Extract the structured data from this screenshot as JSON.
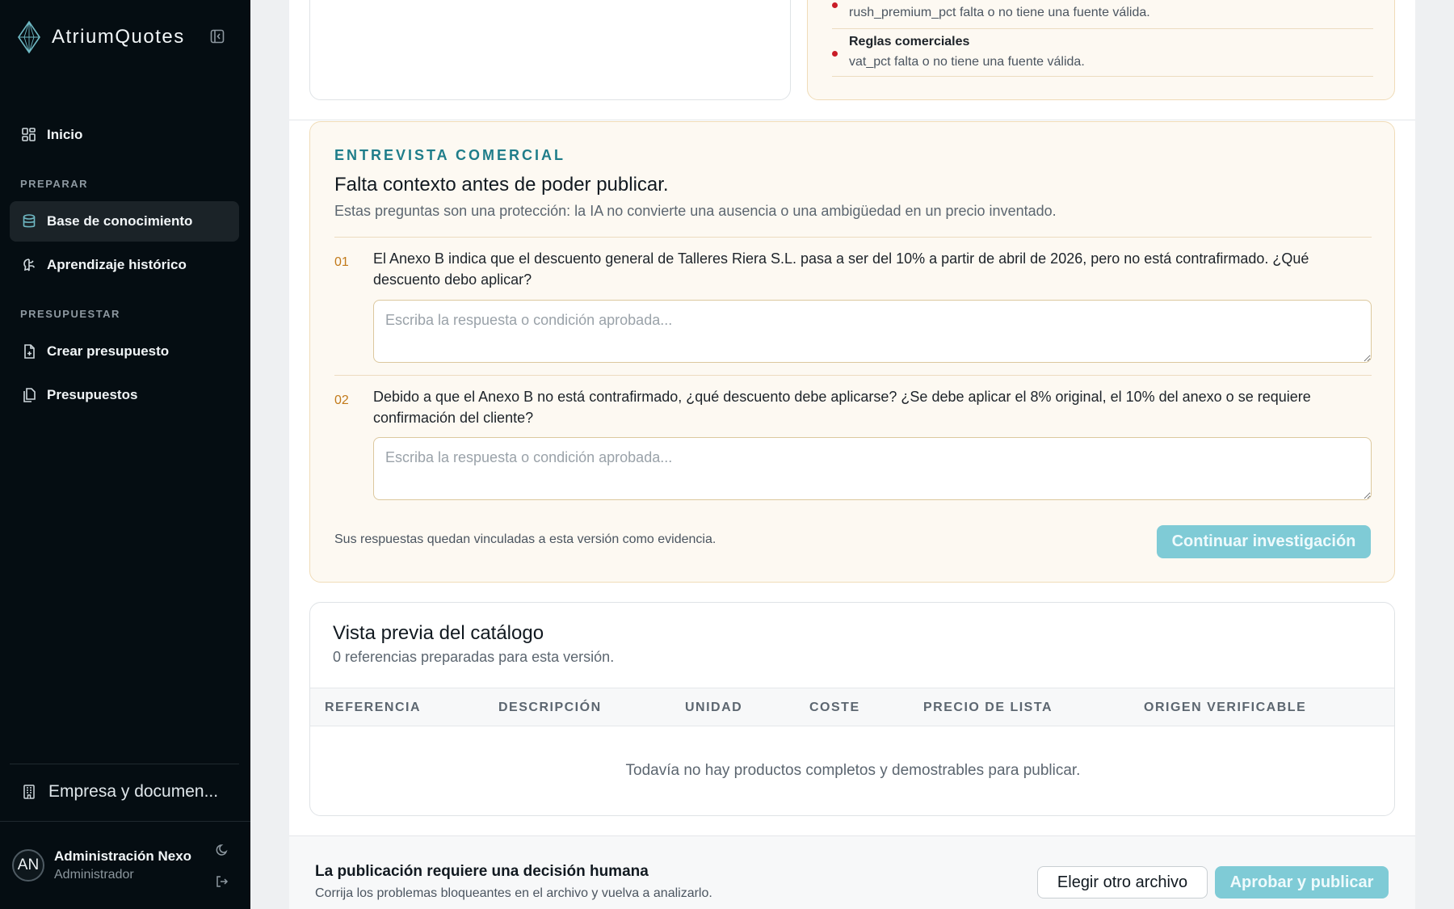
{
  "app": {
    "name": "AtriumQuotes"
  },
  "sidebar": {
    "home": "Inicio",
    "section_prepare": "PREPARAR",
    "knowledge_base": "Base de conocimiento",
    "historical_learning": "Aprendizaje histórico",
    "section_budget": "PRESUPUESTAR",
    "create_quote": "Crear presupuesto",
    "quotes": "Presupuestos",
    "company": "Empresa y documen...",
    "user": {
      "initials": "AN",
      "name": "Administración Nexo",
      "role": "Administrador"
    }
  },
  "issues": [
    {
      "title": "",
      "desc": "rush_premium_pct falta o no tiene una fuente válida."
    },
    {
      "title": "Reglas comerciales",
      "desc": "vat_pct falta o no tiene una fuente válida."
    }
  ],
  "interview": {
    "eyebrow": "ENTREVISTA COMERCIAL",
    "title": "Falta contexto antes de poder publicar.",
    "subtitle": "Estas preguntas son una protección: la IA no convierte una ausencia o una ambigüedad en un precio inventado.",
    "questions": [
      {
        "num": "01",
        "text": "El Anexo B indica que el descuento general de Talleres Riera S.L. pasa a ser del 10% a partir de abril de 2026, pero no está contrafirmado. ¿Qué descuento debo aplicar?",
        "placeholder": "Escriba la respuesta o condición aprobada...",
        "value": ""
      },
      {
        "num": "02",
        "text": "Debido a que el Anexo B no está contrafirmado, ¿qué descuento debe aplicarse? ¿Se debe aplicar el 8% original, el 10% del anexo o se requiere confirmación del cliente?",
        "placeholder": "Escriba la respuesta o condición aprobada...",
        "value": ""
      }
    ],
    "footer_note": "Sus respuestas quedan vinculadas a esta versión como evidencia.",
    "continue_label": "Continuar investigación"
  },
  "catalog": {
    "title": "Vista previa del catálogo",
    "subtitle": "0 referencias preparadas para esta versión.",
    "columns": [
      "REFERENCIA",
      "DESCRIPCIÓN",
      "UNIDAD",
      "COSTE",
      "PRECIO DE LISTA",
      "ORIGEN VERIFICABLE"
    ],
    "empty_text": "Todavía no hay productos completos y demostrables para publicar."
  },
  "publish": {
    "title": "La publicación requiere una decisión humana",
    "subtitle": "Corrija los problemas bloqueantes en el archivo y vuelva a analizarlo.",
    "choose_file": "Elegir otro archivo",
    "approve": "Aprobar y publicar"
  },
  "colors": {
    "sidebar_bg": "#050d12",
    "accent_teal": "#1f7d8a",
    "button_disabled": "#7fcbd6",
    "warning_bg": "#fdf9f2",
    "error_dot": "#c91c27"
  }
}
